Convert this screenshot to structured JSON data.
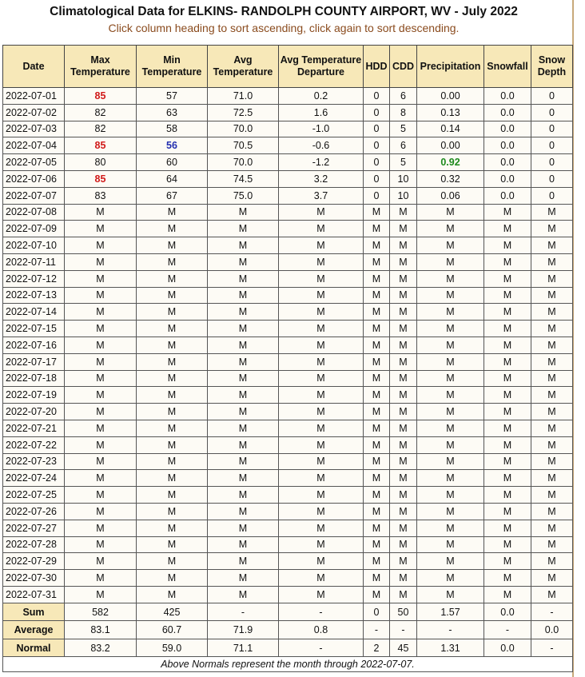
{
  "title": "Climatological Data for ELKINS- RANDOLPH COUNTY AIRPORT, WV - July 2022",
  "subtitle": "Click column heading to sort ascending, click again to sort descending.",
  "colors": {
    "header_bg": "#f7e8b8",
    "highlight_max": "#d11a1a",
    "highlight_min": "#2430b0",
    "highlight_precip": "#1d8a1d"
  },
  "columns": [
    "Date",
    "Max Temperature",
    "Min Temperature",
    "Avg Temperature",
    "Avg Temperature Departure",
    "HDD",
    "CDD",
    "Precipitation",
    "Snowfall",
    "Snow Depth"
  ],
  "rows": [
    {
      "cells": [
        "2022-07-01",
        "85",
        "57",
        "71.0",
        "0.2",
        "0",
        "6",
        "0.00",
        "0.0",
        "0"
      ],
      "hi": {
        "1": "red"
      }
    },
    {
      "cells": [
        "2022-07-02",
        "82",
        "63",
        "72.5",
        "1.6",
        "0",
        "8",
        "0.13",
        "0.0",
        "0"
      ],
      "hi": {}
    },
    {
      "cells": [
        "2022-07-03",
        "82",
        "58",
        "70.0",
        "-1.0",
        "0",
        "5",
        "0.14",
        "0.0",
        "0"
      ],
      "hi": {}
    },
    {
      "cells": [
        "2022-07-04",
        "85",
        "56",
        "70.5",
        "-0.6",
        "0",
        "6",
        "0.00",
        "0.0",
        "0"
      ],
      "hi": {
        "1": "red",
        "2": "blue"
      }
    },
    {
      "cells": [
        "2022-07-05",
        "80",
        "60",
        "70.0",
        "-1.2",
        "0",
        "5",
        "0.92",
        "0.0",
        "0"
      ],
      "hi": {
        "7": "green"
      }
    },
    {
      "cells": [
        "2022-07-06",
        "85",
        "64",
        "74.5",
        "3.2",
        "0",
        "10",
        "0.32",
        "0.0",
        "0"
      ],
      "hi": {
        "1": "red"
      }
    },
    {
      "cells": [
        "2022-07-07",
        "83",
        "67",
        "75.0",
        "3.7",
        "0",
        "10",
        "0.06",
        "0.0",
        "0"
      ],
      "hi": {}
    },
    {
      "cells": [
        "2022-07-08",
        "M",
        "M",
        "M",
        "M",
        "M",
        "M",
        "M",
        "M",
        "M"
      ],
      "hi": {}
    },
    {
      "cells": [
        "2022-07-09",
        "M",
        "M",
        "M",
        "M",
        "M",
        "M",
        "M",
        "M",
        "M"
      ],
      "hi": {}
    },
    {
      "cells": [
        "2022-07-10",
        "M",
        "M",
        "M",
        "M",
        "M",
        "M",
        "M",
        "M",
        "M"
      ],
      "hi": {}
    },
    {
      "cells": [
        "2022-07-11",
        "M",
        "M",
        "M",
        "M",
        "M",
        "M",
        "M",
        "M",
        "M"
      ],
      "hi": {}
    },
    {
      "cells": [
        "2022-07-12",
        "M",
        "M",
        "M",
        "M",
        "M",
        "M",
        "M",
        "M",
        "M"
      ],
      "hi": {}
    },
    {
      "cells": [
        "2022-07-13",
        "M",
        "M",
        "M",
        "M",
        "M",
        "M",
        "M",
        "M",
        "M"
      ],
      "hi": {}
    },
    {
      "cells": [
        "2022-07-14",
        "M",
        "M",
        "M",
        "M",
        "M",
        "M",
        "M",
        "M",
        "M"
      ],
      "hi": {}
    },
    {
      "cells": [
        "2022-07-15",
        "M",
        "M",
        "M",
        "M",
        "M",
        "M",
        "M",
        "M",
        "M"
      ],
      "hi": {}
    },
    {
      "cells": [
        "2022-07-16",
        "M",
        "M",
        "M",
        "M",
        "M",
        "M",
        "M",
        "M",
        "M"
      ],
      "hi": {}
    },
    {
      "cells": [
        "2022-07-17",
        "M",
        "M",
        "M",
        "M",
        "M",
        "M",
        "M",
        "M",
        "M"
      ],
      "hi": {}
    },
    {
      "cells": [
        "2022-07-18",
        "M",
        "M",
        "M",
        "M",
        "M",
        "M",
        "M",
        "M",
        "M"
      ],
      "hi": {}
    },
    {
      "cells": [
        "2022-07-19",
        "M",
        "M",
        "M",
        "M",
        "M",
        "M",
        "M",
        "M",
        "M"
      ],
      "hi": {}
    },
    {
      "cells": [
        "2022-07-20",
        "M",
        "M",
        "M",
        "M",
        "M",
        "M",
        "M",
        "M",
        "M"
      ],
      "hi": {}
    },
    {
      "cells": [
        "2022-07-21",
        "M",
        "M",
        "M",
        "M",
        "M",
        "M",
        "M",
        "M",
        "M"
      ],
      "hi": {}
    },
    {
      "cells": [
        "2022-07-22",
        "M",
        "M",
        "M",
        "M",
        "M",
        "M",
        "M",
        "M",
        "M"
      ],
      "hi": {}
    },
    {
      "cells": [
        "2022-07-23",
        "M",
        "M",
        "M",
        "M",
        "M",
        "M",
        "M",
        "M",
        "M"
      ],
      "hi": {}
    },
    {
      "cells": [
        "2022-07-24",
        "M",
        "M",
        "M",
        "M",
        "M",
        "M",
        "M",
        "M",
        "M"
      ],
      "hi": {}
    },
    {
      "cells": [
        "2022-07-25",
        "M",
        "M",
        "M",
        "M",
        "M",
        "M",
        "M",
        "M",
        "M"
      ],
      "hi": {}
    },
    {
      "cells": [
        "2022-07-26",
        "M",
        "M",
        "M",
        "M",
        "M",
        "M",
        "M",
        "M",
        "M"
      ],
      "hi": {}
    },
    {
      "cells": [
        "2022-07-27",
        "M",
        "M",
        "M",
        "M",
        "M",
        "M",
        "M",
        "M",
        "M"
      ],
      "hi": {}
    },
    {
      "cells": [
        "2022-07-28",
        "M",
        "M",
        "M",
        "M",
        "M",
        "M",
        "M",
        "M",
        "M"
      ],
      "hi": {}
    },
    {
      "cells": [
        "2022-07-29",
        "M",
        "M",
        "M",
        "M",
        "M",
        "M",
        "M",
        "M",
        "M"
      ],
      "hi": {}
    },
    {
      "cells": [
        "2022-07-30",
        "M",
        "M",
        "M",
        "M",
        "M",
        "M",
        "M",
        "M",
        "M"
      ],
      "hi": {}
    },
    {
      "cells": [
        "2022-07-31",
        "M",
        "M",
        "M",
        "M",
        "M",
        "M",
        "M",
        "M",
        "M"
      ],
      "hi": {}
    }
  ],
  "summary": [
    {
      "label": "Sum",
      "cells": [
        "582",
        "425",
        "-",
        "-",
        "0",
        "50",
        "1.57",
        "0.0",
        "-"
      ]
    },
    {
      "label": "Average",
      "cells": [
        "83.1",
        "60.7",
        "71.9",
        "0.8",
        "-",
        "-",
        "-",
        "-",
        "0.0"
      ]
    },
    {
      "label": "Normal",
      "cells": [
        "83.2",
        "59.0",
        "71.1",
        "-",
        "2",
        "45",
        "1.31",
        "0.0",
        "-"
      ]
    }
  ],
  "footnote": "Above Normals represent the month through 2022-07-07."
}
